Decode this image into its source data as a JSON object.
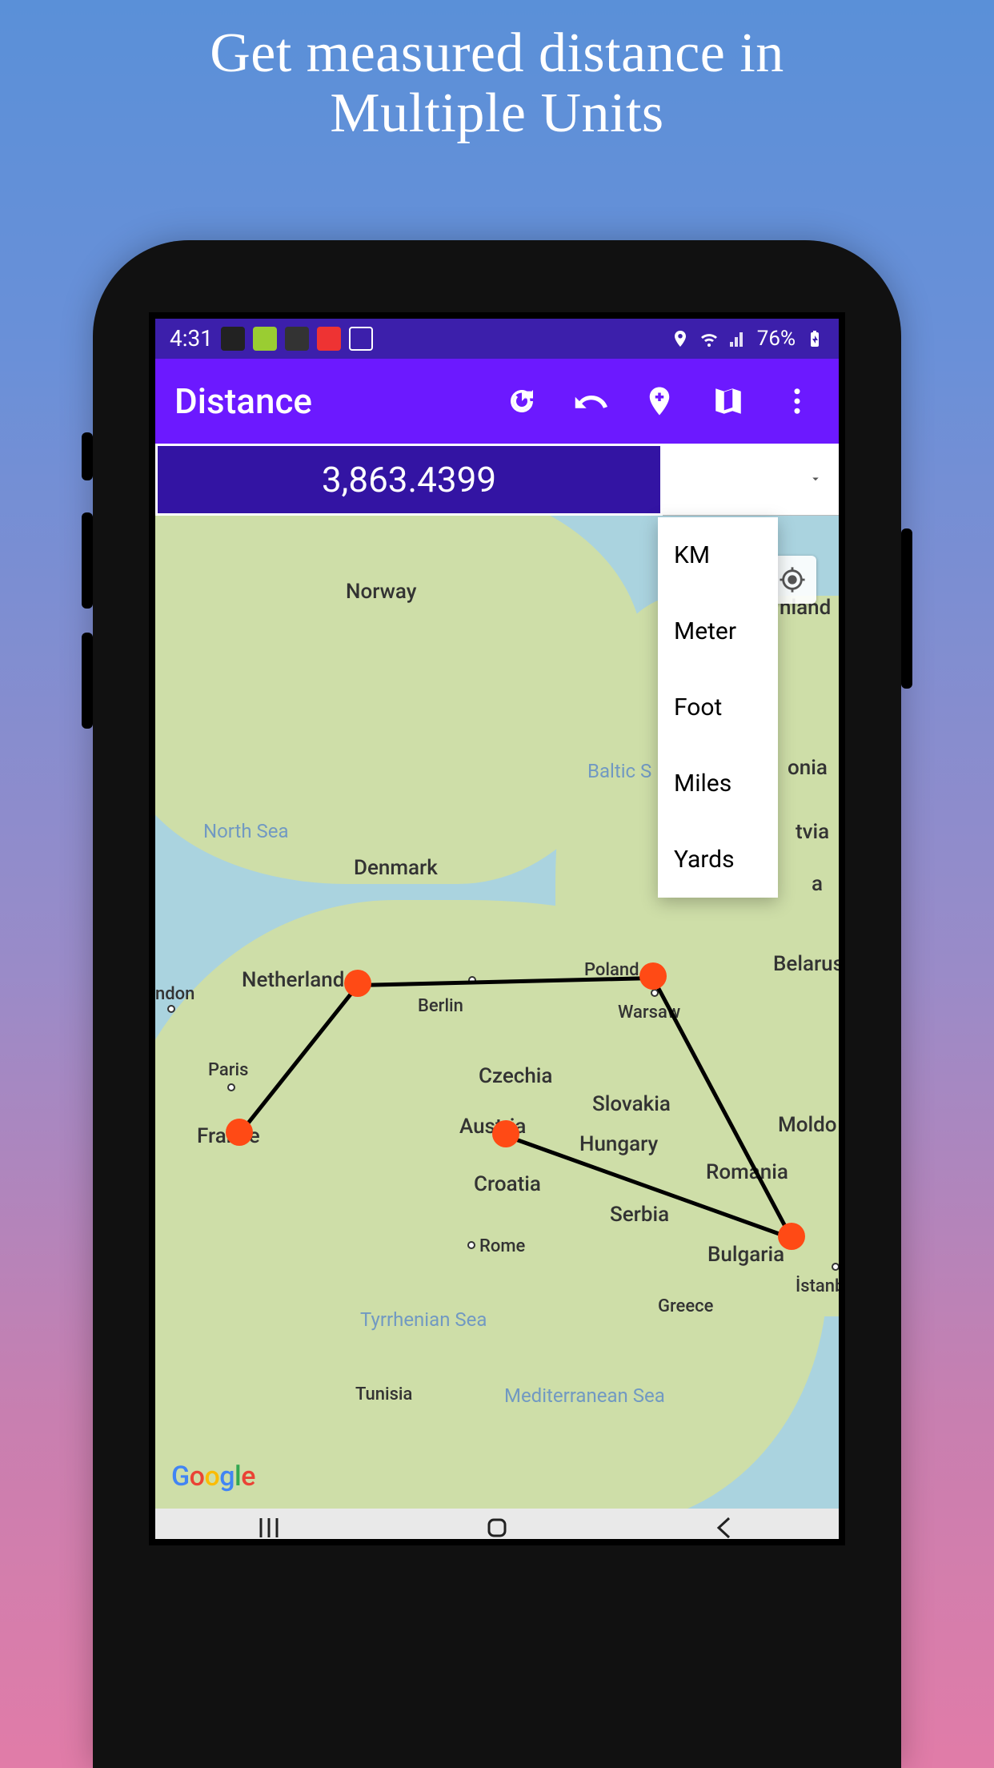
{
  "promo": {
    "title_line1": "Get measured distance in",
    "title_line2": "Multiple Units"
  },
  "status": {
    "time": "4:31",
    "battery": "76%"
  },
  "appbar": {
    "title": "Distance"
  },
  "distance": {
    "value": "3,863.4399"
  },
  "units": {
    "options": [
      "KM",
      "Meter",
      "Foot",
      "Miles",
      "Yards"
    ]
  },
  "map": {
    "labels": {
      "norway": "Norway",
      "north_sea": "North Sea",
      "denmark": "Denmark",
      "baltic_sea": "Baltic S",
      "finland": "nland",
      "estonia": "onia",
      "latvia": "tvia",
      "belarus_frag": "a",
      "belarus": "Belarus",
      "poland": "Poland",
      "warsaw": "Warsaw",
      "netherlands": "Netherlands",
      "london": "ndon",
      "berlin": "Berlin",
      "paris": "Paris",
      "france": "France",
      "czechia": "Czechia",
      "slovakia": "Slovakia",
      "austria": "Austria",
      "hungary": "Hungary",
      "moldova": "Moldo",
      "croatia": "Croatia",
      "romania": "Romania",
      "serbia": "Serbia",
      "rome": "Rome",
      "bulgaria": "Bulgaria",
      "istanbul": "İstanb",
      "greece": "Greece",
      "tyrrhenian": "Tyrrhenian Sea",
      "mediterranean": "Mediterranean Sea",
      "tunisia": "Tunisia"
    },
    "attribution": "Google"
  }
}
